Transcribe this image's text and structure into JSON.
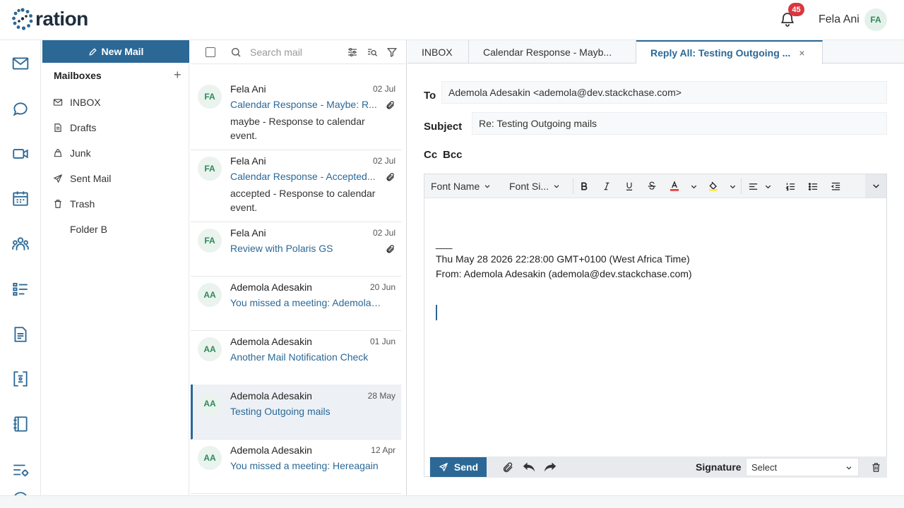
{
  "app": {
    "logo_text": "ration",
    "notification_count": "45",
    "user_name": "Fela Ani",
    "user_initials": "FA"
  },
  "rail": [
    {
      "icon": "mail-icon"
    },
    {
      "icon": "chat-icon"
    },
    {
      "icon": "video-icon"
    },
    {
      "icon": "calendar-icon"
    },
    {
      "icon": "contacts-icon"
    },
    {
      "icon": "tasks-icon"
    },
    {
      "icon": "document-icon"
    },
    {
      "icon": "drive-icon"
    },
    {
      "icon": "notebook-icon"
    },
    {
      "icon": "settings-list-icon"
    }
  ],
  "mailboxes": {
    "new_mail_label": "New Mail",
    "title": "Mailboxes",
    "add_label": "+",
    "folders": [
      {
        "label": "INBOX",
        "icon": "inbox-icon"
      },
      {
        "label": "Drafts",
        "icon": "drafts-icon"
      },
      {
        "label": "Junk",
        "icon": "junk-icon"
      },
      {
        "label": "Sent Mail",
        "icon": "sent-icon"
      },
      {
        "label": "Trash",
        "icon": "trash-icon"
      },
      {
        "label": "Folder B",
        "icon": ""
      }
    ]
  },
  "search": {
    "placeholder": "Search mail"
  },
  "mails": [
    {
      "initials": "FA",
      "sender": "Fela Ani",
      "date": "02 Jul",
      "subject": "Calendar Response - Maybe: R...",
      "preview": "maybe - Response to calendar event.",
      "attachment": true
    },
    {
      "initials": "FA",
      "sender": "Fela Ani",
      "date": "02 Jul",
      "subject": "Calendar Response - Accepted...",
      "preview": "accepted - Response to calendar event.",
      "attachment": true
    },
    {
      "initials": "FA",
      "sender": "Fela Ani",
      "date": "02 Jul",
      "subject": "Review with Polaris GS",
      "preview": "",
      "attachment": true
    },
    {
      "initials": "AA",
      "sender": "Ademola Adesakin",
      "date": "20 Jun",
      "subject": "You missed a meeting: Ademola's ...",
      "preview": "",
      "attachment": false
    },
    {
      "initials": "AA",
      "sender": "Ademola Adesakin",
      "date": "01 Jun",
      "subject": "Another Mail Notification Check",
      "preview": "",
      "attachment": false
    },
    {
      "initials": "AA",
      "sender": "Ademola Adesakin",
      "date": "28 May",
      "subject": "Testing Outgoing mails",
      "preview": "",
      "attachment": false,
      "selected": true
    },
    {
      "initials": "AA",
      "sender": "Ademola Adesakin",
      "date": "12 Apr",
      "subject": "You missed a meeting: Hereagain",
      "preview": "",
      "attachment": false
    }
  ],
  "tabs": [
    {
      "label": "INBOX"
    },
    {
      "label": "Calendar Response - Mayb..."
    },
    {
      "label": "Reply All: Testing Outgoing ...",
      "active": true,
      "close": "×"
    }
  ],
  "compose": {
    "to_label": "To",
    "to_value": "Ademola Adesakin <ademola@dev.stackchase.com>",
    "subject_label": "Subject",
    "subject_value": "Re: Testing Outgoing mails",
    "cc_label": "Cc",
    "bcc_label": "Bcc",
    "toolbar": {
      "font_name": "Font Name",
      "font_size": "Font Si..."
    },
    "body": {
      "separator": "___",
      "date_line": "Thu May 28 2026 22:28:00 GMT+0100 (West Africa Time)",
      "from_line": "From: Ademola Adesakin (ademola@dev.stackchase.com)"
    },
    "send_label": "Send",
    "signature_label": "Signature",
    "signature_value": "Select"
  },
  "colors": {
    "accent": "#2b6896",
    "badge": "#d9363e",
    "avatar_bg": "#eaf3ee",
    "avatar_fg": "#2f8a5a"
  }
}
